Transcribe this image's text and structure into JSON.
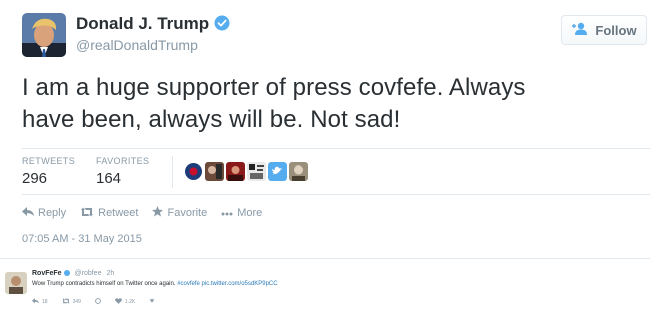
{
  "author": {
    "name": "Donald J. Trump",
    "handle": "@realDonaldTrump",
    "verified_icon": "verified-badge-icon",
    "accent_color": "#55acee"
  },
  "follow_button": {
    "label": "Follow",
    "icon": "add-user-icon"
  },
  "tweet": {
    "line1": "I am a huge supporter of press covfefe. Always",
    "line2": "have been, always will be. Not sad!"
  },
  "stats": {
    "retweets_label": "RETWEETS",
    "retweets_value": "296",
    "favorites_label": "FAVORITES",
    "favorites_value": "164"
  },
  "actions": [
    {
      "label": "Reply",
      "icon": "reply-icon"
    },
    {
      "label": "Retweet",
      "icon": "retweet-icon"
    },
    {
      "label": "Favorite",
      "icon": "star-icon"
    },
    {
      "label": "More",
      "icon": "more-dots-icon"
    }
  ],
  "timestamp": "07:05 AM - 31 May 2015",
  "reply": {
    "name": "RovFeFe",
    "handle": "@robfee",
    "time": "2h",
    "text_prefix": "Wow Trump contradicts himself on Twitter once again. ",
    "hashtag": "#covfefe",
    "link": "pic.twitter.com/o5sdKP9pCC",
    "actions": [
      {
        "icon": "reply-icon",
        "count": "18"
      },
      {
        "icon": "retweet-icon",
        "count": "349"
      },
      {
        "icon": "bookmark-icon",
        "count": ""
      },
      {
        "icon": "heart-icon",
        "count": "1.2K"
      },
      {
        "icon": "more-icon",
        "count": ""
      }
    ]
  }
}
